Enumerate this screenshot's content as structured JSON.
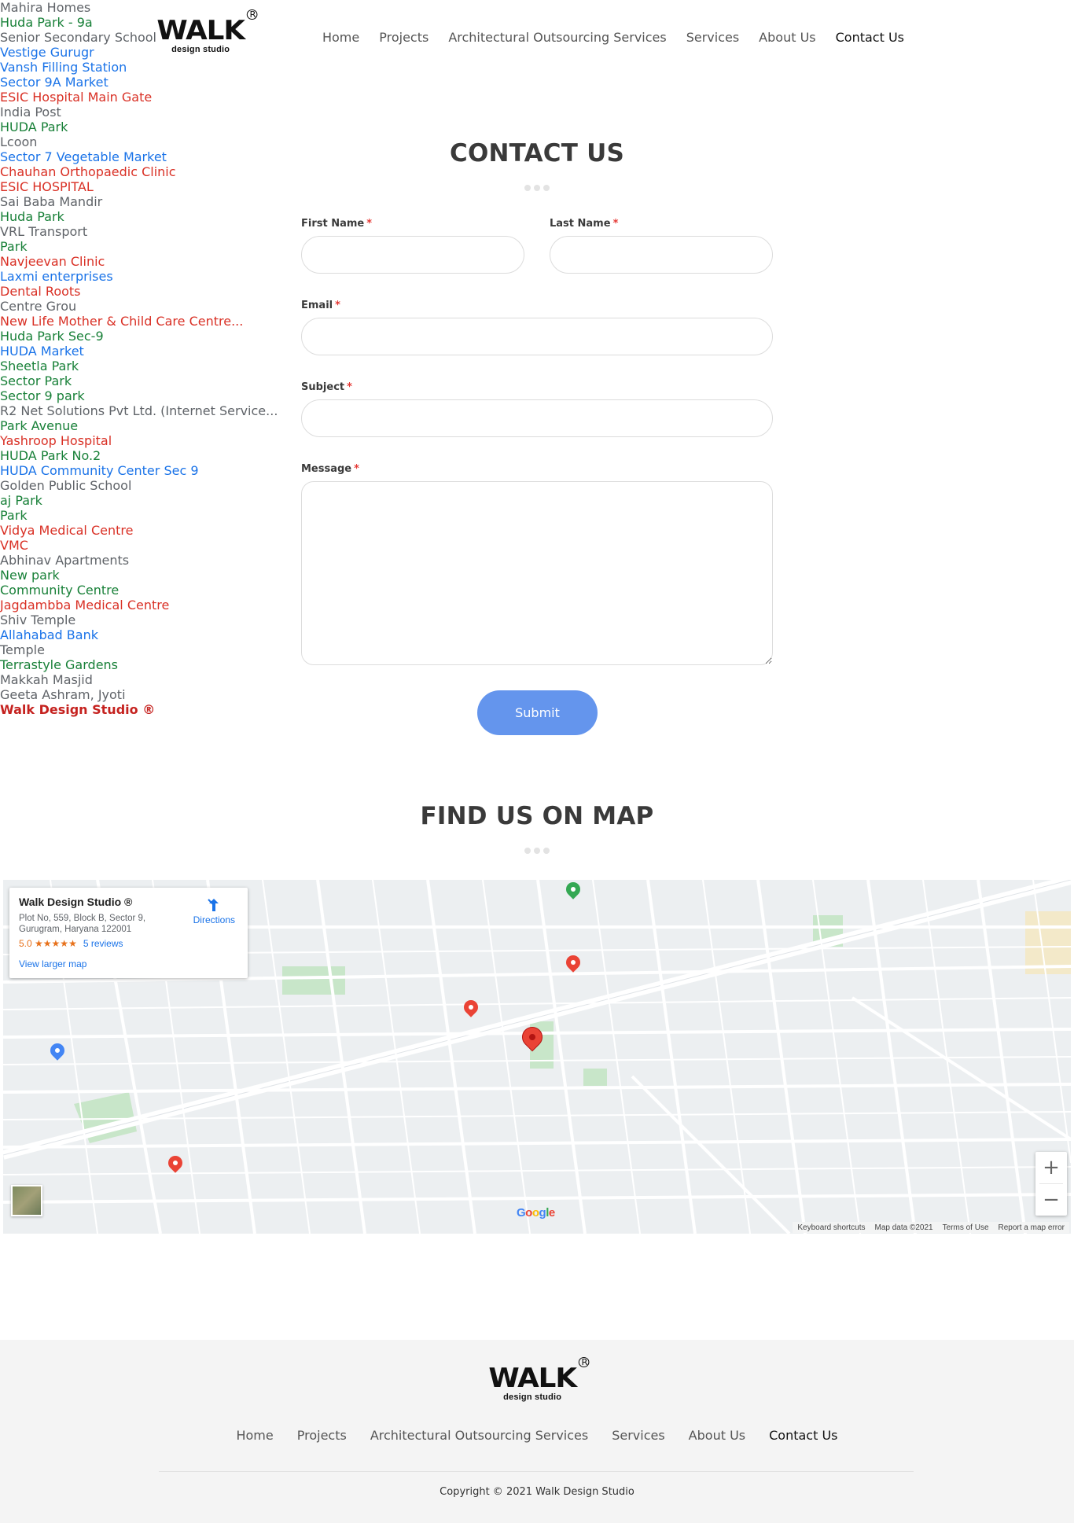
{
  "header": {
    "logo_word": "WALK",
    "logo_reg": "R",
    "logo_sub": "design studio",
    "nav": [
      "Home",
      "Projects",
      "Architectural Outsourcing Services",
      "Services",
      "About Us",
      "Contact Us"
    ],
    "active_nav": "Contact Us"
  },
  "contact": {
    "title": "CONTACT US",
    "fields": {
      "first_name": {
        "label": "First Name",
        "value": "",
        "placeholder": ""
      },
      "last_name": {
        "label": "Last Name",
        "value": "",
        "placeholder": ""
      },
      "email": {
        "label": "Email",
        "value": "",
        "placeholder": ""
      },
      "subject": {
        "label": "Subject",
        "value": "",
        "placeholder": ""
      },
      "message": {
        "label": "Message",
        "value": "",
        "placeholder": ""
      }
    },
    "required_marker": "*",
    "submit_label": "Submit"
  },
  "map_section": {
    "title": "FIND US ON MAP",
    "card": {
      "name": "Walk Design Studio ®",
      "address": "Plot No, 559, Block B, Sector 9, Gurugram, Haryana 122001",
      "rating": "5.0",
      "stars": "★★★★★",
      "reviews": "5 reviews",
      "directions": "Directions",
      "larger_map": "View larger map"
    },
    "main_marker": "Walk Design Studio ®",
    "places": [
      {
        "text": "Mahira Homes",
        "color": "gray"
      },
      {
        "text": "Huda Park - 9a",
        "color": "green"
      },
      {
        "text": "Senior Secondary School",
        "color": "gray"
      },
      {
        "text": "Vestige Gurugr",
        "color": "blue"
      },
      {
        "text": "Vansh Filling Station",
        "color": "blue"
      },
      {
        "text": "Sector 9A Market",
        "color": "blue"
      },
      {
        "text": "ESIC Hospital Main Gate",
        "color": "red"
      },
      {
        "text": "India Post",
        "color": "gray"
      },
      {
        "text": "HUDA Park",
        "color": "green"
      },
      {
        "text": "Lcoon",
        "color": "gray"
      },
      {
        "text": "Sector 7 Vegetable Market",
        "color": "blue"
      },
      {
        "text": "Chauhan Orthopaedic Clinic",
        "color": "red"
      },
      {
        "text": "ESIC HOSPITAL",
        "color": "red"
      },
      {
        "text": "Sai Baba Mandir",
        "color": "gray"
      },
      {
        "text": "Huda Park",
        "color": "green"
      },
      {
        "text": "VRL Transport",
        "color": "gray"
      },
      {
        "text": "Park",
        "color": "green"
      },
      {
        "text": "Navjeevan Clinic",
        "color": "red"
      },
      {
        "text": "Laxmi enterprises",
        "color": "blue"
      },
      {
        "text": "Dental Roots",
        "color": "red"
      },
      {
        "text": "Centre Grou",
        "color": "gray"
      },
      {
        "text": "New Life Mother & Child Care Centre...",
        "color": "red"
      },
      {
        "text": "Huda Park Sec-9",
        "color": "green"
      },
      {
        "text": "HUDA Market",
        "color": "blue"
      },
      {
        "text": "Sheetla Park",
        "color": "green"
      },
      {
        "text": "Sector Park",
        "color": "green"
      },
      {
        "text": "Sector 9 park",
        "color": "green"
      },
      {
        "text": "R2 Net Solutions Pvt Ltd. (Internet Service...",
        "color": "gray"
      },
      {
        "text": "Park Avenue",
        "color": "green"
      },
      {
        "text": "Yashroop Hospital",
        "color": "red"
      },
      {
        "text": "HUDA Park No.2",
        "color": "green"
      },
      {
        "text": "HUDA Community Center Sec 9",
        "color": "blue"
      },
      {
        "text": "Golden Public School",
        "color": "gray"
      },
      {
        "text": "aj Park",
        "color": "green"
      },
      {
        "text": "Park",
        "color": "green"
      },
      {
        "text": "Vidya Medical Centre",
        "color": "red"
      },
      {
        "text": "VMC",
        "color": "red"
      },
      {
        "text": "Abhinav Apartments",
        "color": "gray"
      },
      {
        "text": "New park",
        "color": "green"
      },
      {
        "text": "Community Centre",
        "color": "green"
      },
      {
        "text": "Jagdambba Medical Centre",
        "color": "red"
      },
      {
        "text": "Shiv Temple",
        "color": "gray"
      },
      {
        "text": "Allahabad Bank",
        "color": "blue"
      },
      {
        "text": "Temple",
        "color": "gray"
      },
      {
        "text": "Terrastyle Gardens",
        "color": "green"
      },
      {
        "text": "Makkah Masjid",
        "color": "gray"
      },
      {
        "text": "Geeta Ashram, Jyoti",
        "color": "gray"
      }
    ],
    "footer": [
      "Keyboard shortcuts",
      "Map data ©2021",
      "Terms of Use",
      "Report a map error"
    ],
    "zoom_in": "+",
    "zoom_out": "−",
    "google": "Google"
  },
  "footer": {
    "logo_word": "WALK",
    "logo_reg": "R",
    "logo_sub": "design studio",
    "nav": [
      "Home",
      "Projects",
      "Architectural Outsourcing Services",
      "Services",
      "About Us",
      "Contact Us"
    ],
    "copyright": "Copyright © 2021 Walk Design Studio"
  },
  "colors": {
    "accent": "#6495ed",
    "required": "#e53935",
    "footer_bg": "#f4f4f4"
  }
}
